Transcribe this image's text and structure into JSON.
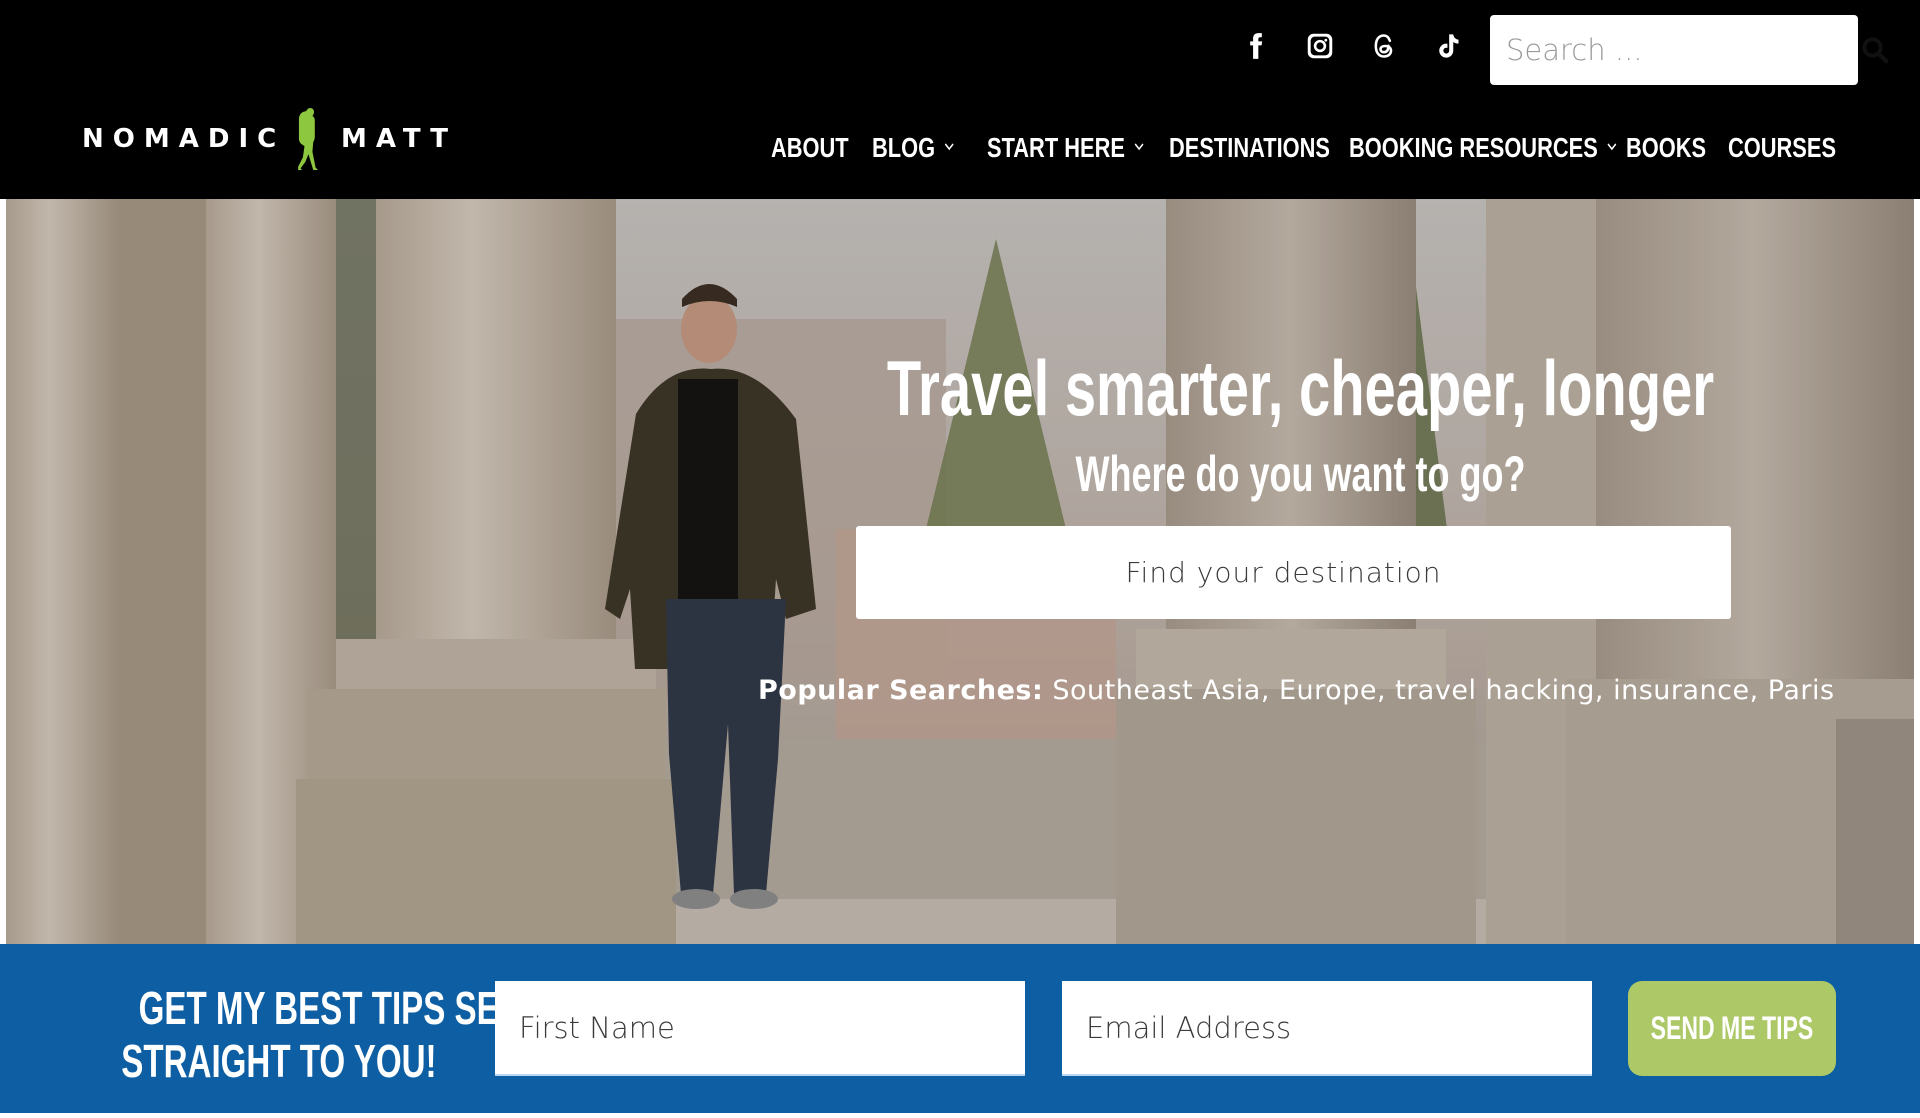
{
  "brand": {
    "left_word": "NOMADIC",
    "right_word": "MATT",
    "logo_green": "#8dc63f"
  },
  "social": [
    {
      "name": "facebook",
      "icon": "facebook-icon"
    },
    {
      "name": "instagram",
      "icon": "instagram-icon"
    },
    {
      "name": "threads",
      "icon": "threads-icon"
    },
    {
      "name": "tiktok",
      "icon": "tiktok-icon"
    }
  ],
  "search": {
    "placeholder": "Search ...",
    "icon": "search-icon"
  },
  "nav": {
    "items": [
      {
        "label": "ABOUT",
        "dropdown": false
      },
      {
        "label": "BLOG",
        "dropdown": true
      },
      {
        "label": "START HERE",
        "dropdown": true
      },
      {
        "label": "DESTINATIONS",
        "dropdown": false
      },
      {
        "label": "BOOKING RESOURCES",
        "dropdown": true
      },
      {
        "label": "BOOKS",
        "dropdown": false
      },
      {
        "label": "COURSES",
        "dropdown": false
      }
    ]
  },
  "hero": {
    "title": "Travel smarter, cheaper, longer",
    "subtitle": "Where do you want to go?",
    "destination_placeholder": "Find your destination",
    "popular_label": "Popular Searches:",
    "popular_searches": [
      "Southeast Asia",
      "Europe",
      "travel hacking",
      "insurance",
      "Paris"
    ]
  },
  "optin": {
    "heading_line1": "GET MY BEST TIPS SENT",
    "heading_line2": "STRAIGHT TO YOU!",
    "first_name_placeholder": "First Name",
    "email_placeholder": "Email Address",
    "button_label": "SEND ME TIPS",
    "band_color": "#0d5ea3",
    "button_color": "#adc866"
  }
}
